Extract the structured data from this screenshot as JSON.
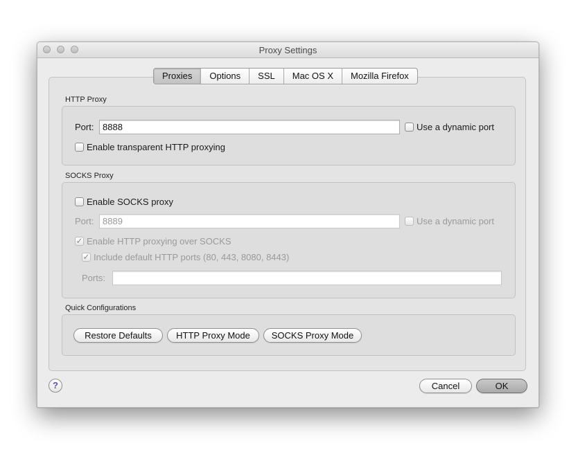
{
  "window": {
    "title": "Proxy Settings"
  },
  "tabs": [
    {
      "label": "Proxies",
      "selected": true
    },
    {
      "label": "Options",
      "selected": false
    },
    {
      "label": "SSL",
      "selected": false
    },
    {
      "label": "Mac OS X",
      "selected": false
    },
    {
      "label": "Mozilla Firefox",
      "selected": false
    }
  ],
  "http_proxy": {
    "section_label": "HTTP Proxy",
    "port_label": "Port:",
    "port_value": "8888",
    "dynamic_port_label": "Use a dynamic port",
    "dynamic_port_checked": false,
    "transparent_label": "Enable transparent HTTP proxying",
    "transparent_checked": false
  },
  "socks_proxy": {
    "section_label": "SOCKS Proxy",
    "enable_label": "Enable SOCKS proxy",
    "enable_checked": false,
    "port_label": "Port:",
    "port_value": "8889",
    "dynamic_port_label": "Use a dynamic port",
    "dynamic_port_checked": false,
    "http_over_socks_label": "Enable HTTP proxying over SOCKS",
    "http_over_socks_checked": true,
    "default_ports_label": "Include default HTTP ports (80, 443, 8080, 8443)",
    "default_ports_checked": true,
    "ports_label": "Ports:",
    "ports_value": ""
  },
  "quick_config": {
    "section_label": "Quick Configurations",
    "restore_label": "Restore Defaults",
    "http_mode_label": "HTTP Proxy Mode",
    "socks_mode_label": "SOCKS Proxy Mode"
  },
  "footer": {
    "help_label": "?",
    "cancel_label": "Cancel",
    "ok_label": "OK"
  },
  "icons": {
    "checkmark": "✓",
    "help_icon": "question-mark"
  }
}
